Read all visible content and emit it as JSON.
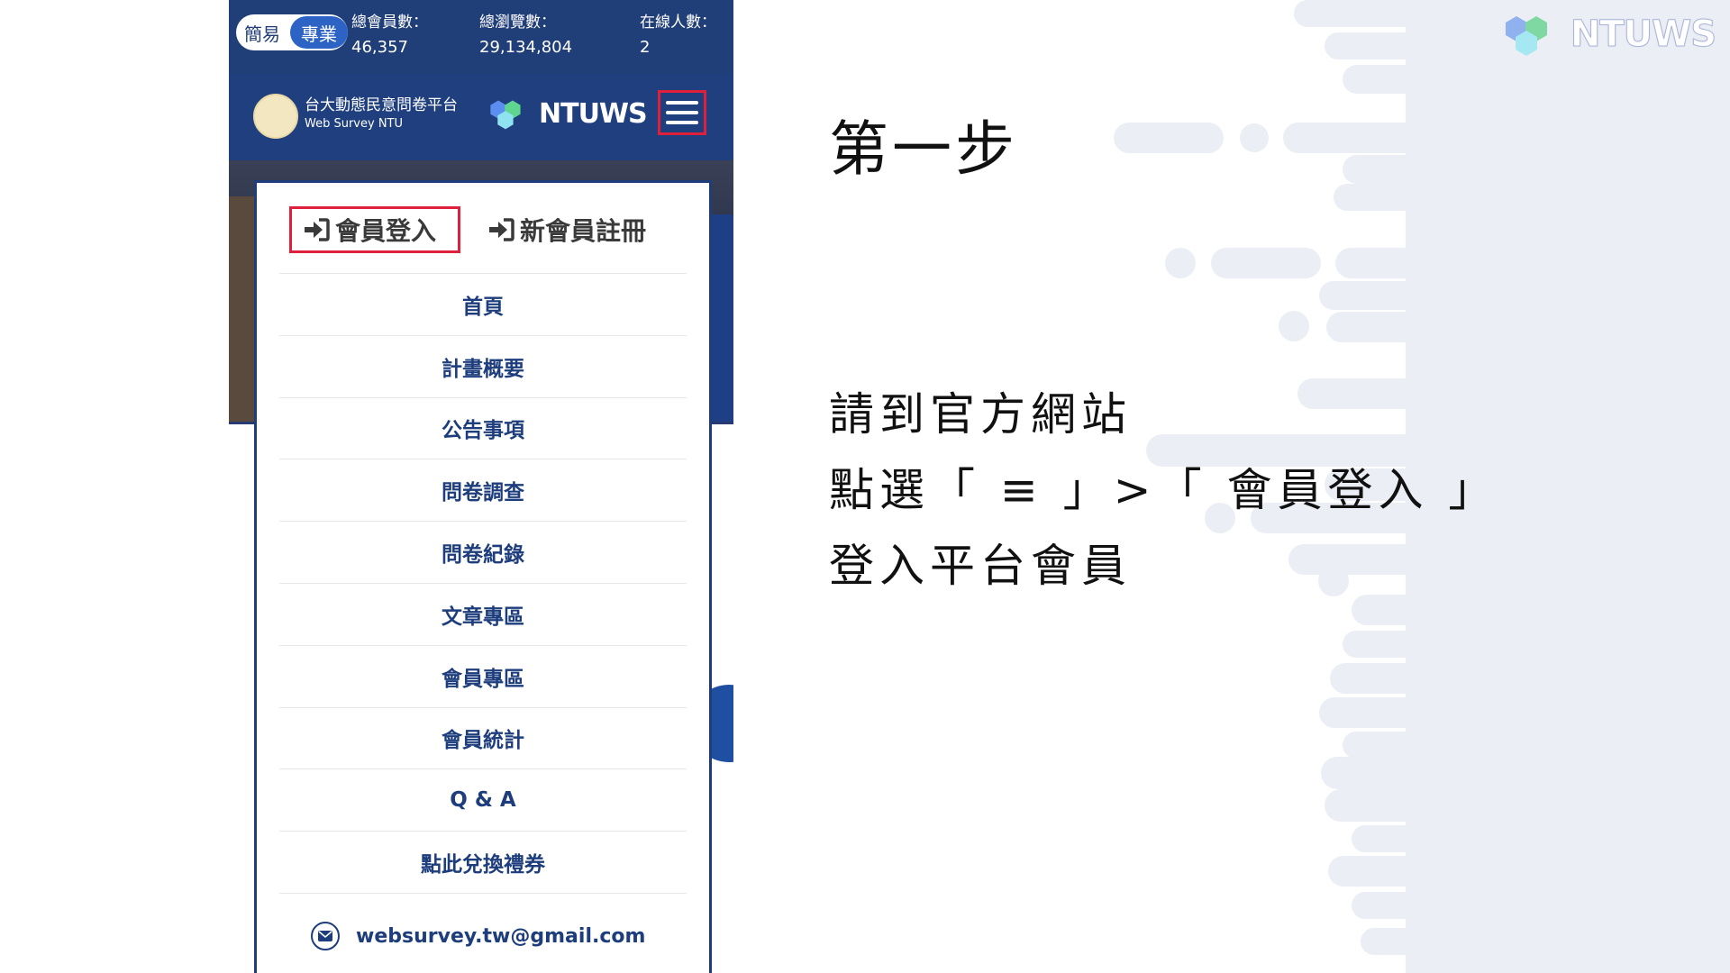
{
  "brand": {
    "logo_text": "NTUWS",
    "logo_icon": "hexagon-cluster-icon"
  },
  "phone": {
    "mode_toggle": {
      "simple_label": "簡易",
      "pro_label": "專業"
    },
    "stats": [
      {
        "label": "總會員數：",
        "value": "46,357"
      },
      {
        "label": "總瀏覽數：",
        "value": "29,134,804"
      },
      {
        "label": "在線人數：",
        "value": "2"
      }
    ],
    "header": {
      "site_title": "台大動態民意問卷平台",
      "site_subtitle": "Web Survey NTU",
      "logo_text": "NTUWS",
      "menu_icon": "hamburger-menu-icon"
    },
    "menu": {
      "login_label": "會員登入",
      "register_label": "新會員註冊",
      "items": [
        "首頁",
        "計畫概要",
        "公告事項",
        "問卷調查",
        "問卷紀錄",
        "文章專區",
        "會員專區",
        "會員統計",
        "Q & A",
        "點此兌換禮券"
      ],
      "contact_email": "websurvey.tw@gmail.com"
    }
  },
  "instructions": {
    "step_title": "第一步",
    "lines": [
      "請到官方網站",
      "點選「 ≡ 」>「 會員登入 」",
      "登入平台會員"
    ]
  },
  "colors": {
    "nav_blue": "#1f3f7e",
    "menu_text": "#1d3d7c",
    "highlight_red": "#e0203a",
    "deco_gray": "#eceef5"
  }
}
